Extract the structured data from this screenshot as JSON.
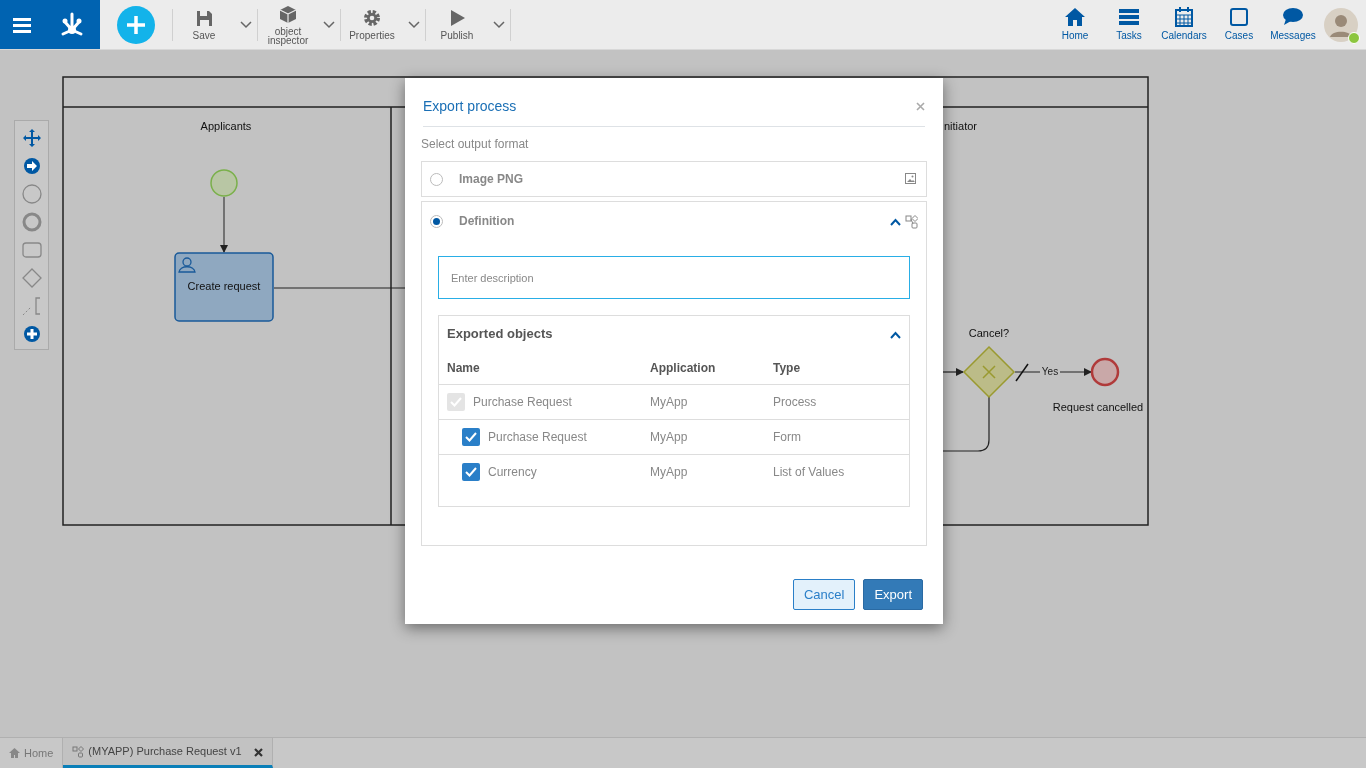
{
  "toolbar": {
    "items": [
      {
        "kind": "save",
        "label": "Save"
      },
      {
        "kind": "inspector",
        "label": "object inspector"
      },
      {
        "kind": "properties",
        "label": "Properties"
      },
      {
        "kind": "publish",
        "label": "Publish"
      }
    ]
  },
  "nav": [
    {
      "kind": "home",
      "label": "Home"
    },
    {
      "kind": "tasks",
      "label": "Tasks"
    },
    {
      "kind": "calendars",
      "label": "Calendars"
    },
    {
      "kind": "cases",
      "label": "Cases"
    },
    {
      "kind": "messages",
      "label": "Messages"
    }
  ],
  "user": {
    "online": true
  },
  "diagram": {
    "lanes": [
      {
        "label": "Applicants"
      },
      {
        "label": "nitiator"
      }
    ],
    "nodes": [
      {
        "kind": "start"
      },
      {
        "kind": "task",
        "label": "Create request"
      },
      {
        "kind": "gateway",
        "label": "Cancel?"
      },
      {
        "kind": "end",
        "label": "Request cancelled"
      }
    ],
    "flow_labels": [
      "Yes"
    ]
  },
  "modal": {
    "title": "Export process",
    "subtitle": "Select output format",
    "options": [
      {
        "kind": "image",
        "label": "Image PNG",
        "selected": false,
        "expanded": false
      },
      {
        "kind": "definition",
        "label": "Definition",
        "selected": true,
        "expanded": true
      }
    ],
    "description": {
      "placeholder": "Enter description"
    },
    "objects": {
      "title": "Exported objects",
      "expanded": true,
      "columns": [
        "Name",
        "Application",
        "Type"
      ],
      "rows": [
        {
          "name": "Purchase Request",
          "application": "MyApp",
          "type": "Process",
          "checked": true,
          "disabled": true,
          "children": [
            {
              "name": "Purchase Request",
              "application": "MyApp",
              "type": "Form",
              "checked": true,
              "disabled": false
            },
            {
              "name": "Currency",
              "application": "MyApp",
              "type": "List of Values",
              "checked": true,
              "disabled": false
            }
          ]
        }
      ]
    },
    "buttons": [
      {
        "kind": "secondary",
        "label": "Cancel"
      },
      {
        "kind": "primary",
        "label": "Export"
      }
    ]
  },
  "tabs": [
    {
      "kind": "home",
      "label": "Home",
      "selected": false,
      "closable": false
    },
    {
      "kind": "process",
      "label": "(MYAPP) Purchase Request v1",
      "selected": true,
      "closable": true
    }
  ]
}
